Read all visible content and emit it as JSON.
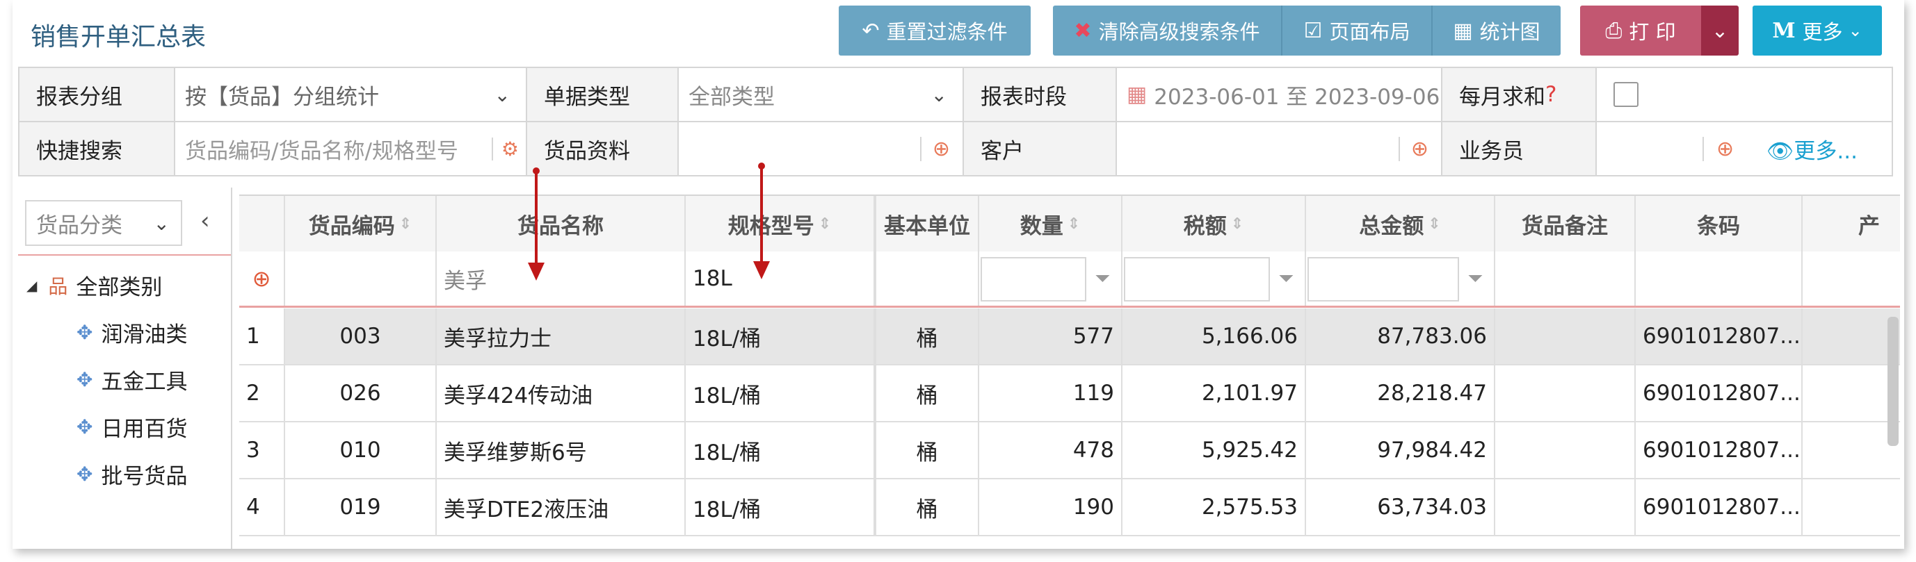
{
  "title": "销售开单汇总表",
  "toolbar": {
    "reset_filter": "重置过滤条件",
    "clear_advanced": "清除高级搜索条件",
    "page_layout": "页面布局",
    "stats_chart": "统计图",
    "print": "打 印",
    "more": "更多"
  },
  "filters": {
    "group_label": "报表分组",
    "group_value": "按【货品】分组统计",
    "doc_type_label": "单据类型",
    "doc_type_value": "全部类型",
    "period_label": "报表时段",
    "period_value": "2023-06-01 至 2023-09-06",
    "monthly_sum_label": "每月求和",
    "monthly_sum_q": "?",
    "quick_search_label": "快捷搜索",
    "quick_search_placeholder": "货品编码/货品名称/规格型号",
    "goods_label": "货品资料",
    "customer_label": "客户",
    "salesman_label": "业务员",
    "more_link": "更多..."
  },
  "tree": {
    "select_placeholder": "货品分类",
    "root": "全部类别",
    "items": [
      "润滑油类",
      "五金工具",
      "日用百货",
      "批号货品"
    ]
  },
  "grid": {
    "headers": {
      "code": "货品编码",
      "name": "货品名称",
      "spec": "规格型号",
      "unit": "基本单位",
      "qty": "数量",
      "tax": "税额",
      "total": "总金额",
      "remark": "货品备注",
      "barcode": "条码",
      "extra": "产"
    },
    "filter_row": {
      "name": "美孚",
      "spec": "18L"
    },
    "rows": [
      {
        "no": "1",
        "code": "003",
        "name": "美孚拉力士",
        "spec": "18L/桶",
        "unit": "桶",
        "qty": "577",
        "tax": "5,166.06",
        "total": "87,783.06",
        "remark": "",
        "barcode": "6901012807..."
      },
      {
        "no": "2",
        "code": "026",
        "name": "美孚424传动油",
        "spec": "18L/桶",
        "unit": "桶",
        "qty": "119",
        "tax": "2,101.97",
        "total": "28,218.47",
        "remark": "",
        "barcode": "6901012807..."
      },
      {
        "no": "3",
        "code": "010",
        "name": "美孚维萝斯6号",
        "spec": "18L/桶",
        "unit": "桶",
        "qty": "478",
        "tax": "5,925.42",
        "total": "97,984.42",
        "remark": "",
        "barcode": "6901012807..."
      },
      {
        "no": "4",
        "code": "019",
        "name": "美孚DTE2液压油",
        "spec": "18L/桶",
        "unit": "桶",
        "qty": "190",
        "tax": "2,575.53",
        "total": "63,734.03",
        "remark": "",
        "barcode": "6901012807..."
      }
    ]
  }
}
